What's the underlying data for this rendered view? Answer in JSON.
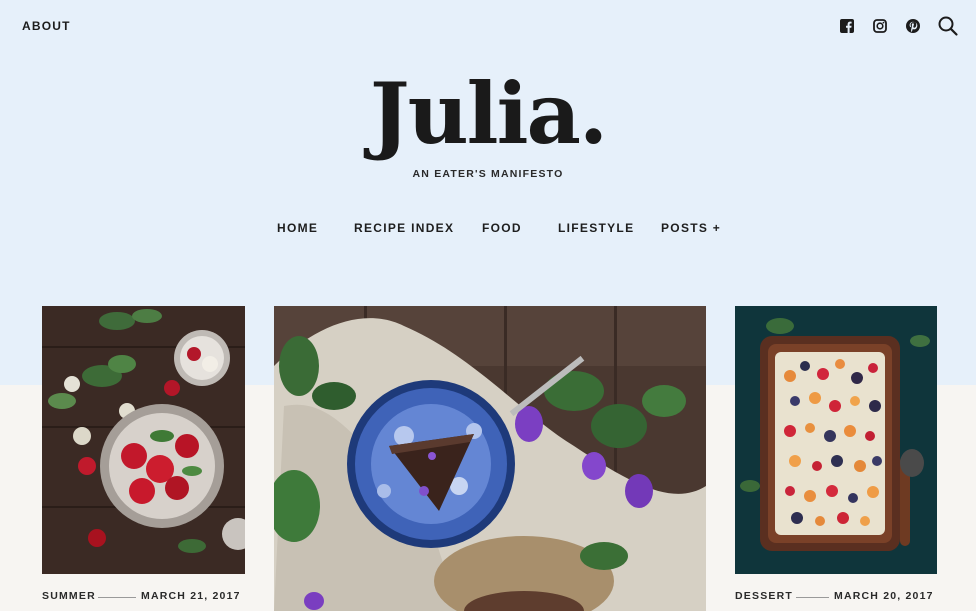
{
  "header": {
    "about_label": "ABOUT",
    "social_icons": [
      "facebook-icon",
      "instagram-icon",
      "pinterest-icon"
    ],
    "search_icon": "search-icon"
  },
  "brand": {
    "logo": "Julia.",
    "tagline": "AN EATER'S MANIFESTO"
  },
  "nav": {
    "items": [
      {
        "label": "HOME"
      },
      {
        "label": "RECIPE INDEX"
      },
      {
        "label": "FOOD"
      },
      {
        "label": "LIFESTYLE"
      },
      {
        "label": "POSTS +"
      }
    ]
  },
  "posts": [
    {
      "category": "SUMMER",
      "date": "MARCH 21, 2017",
      "image": "strawberries-and-ice-cream"
    },
    {
      "category": "",
      "date": "",
      "image": "chocolate-cake-on-blue-plate"
    },
    {
      "category": "DESSERT",
      "date": "MARCH 20, 2017",
      "image": "berry-tart-in-baking-dish"
    }
  ],
  "colors": {
    "hero_background": "#e6f0fa",
    "page_background": "#f7f5f2",
    "text": "#1c1c1c"
  }
}
